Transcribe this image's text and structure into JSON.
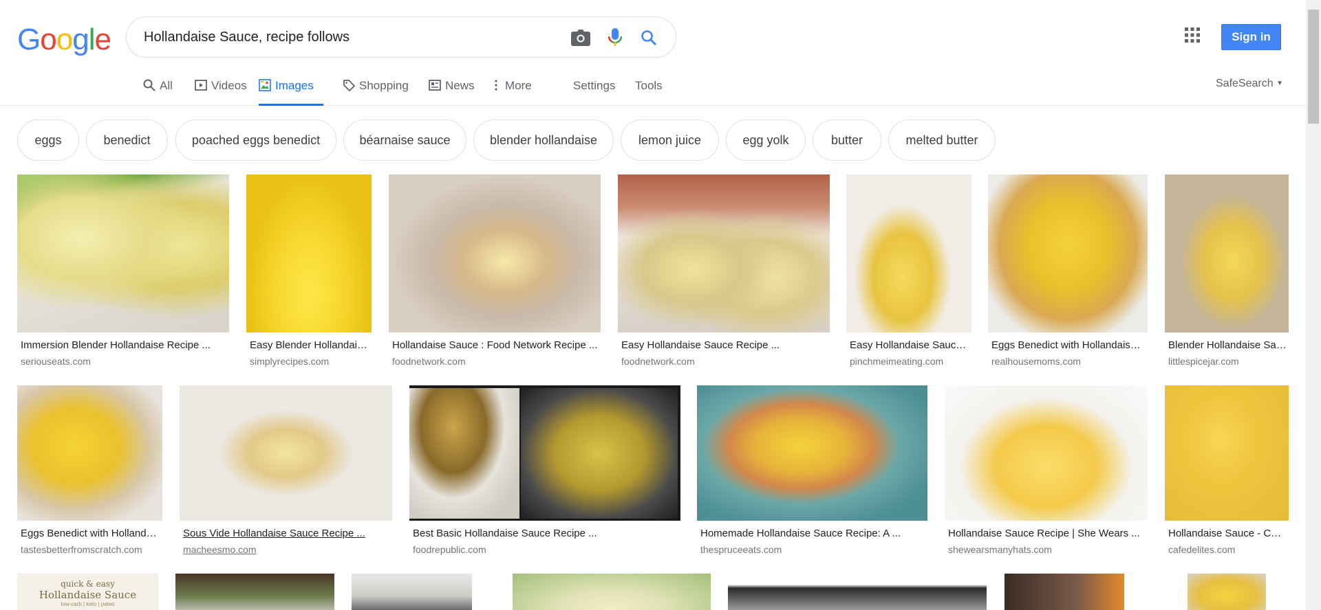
{
  "logo": {
    "letters": [
      "G",
      "o",
      "o",
      "g",
      "l",
      "e"
    ],
    "colors": [
      "#4285f4",
      "#ea4335",
      "#fbbc05",
      "#4285f4",
      "#34a853",
      "#ea4335"
    ]
  },
  "search": {
    "query": "Hollandaise Sauce, recipe follows"
  },
  "header": {
    "sign_in": "Sign in",
    "safesearch": "SafeSearch"
  },
  "tabs": [
    {
      "label": "All",
      "icon": "search-icon"
    },
    {
      "label": "Videos",
      "icon": "video-icon"
    },
    {
      "label": "Images",
      "icon": "image-icon",
      "active": true
    },
    {
      "label": "Shopping",
      "icon": "tag-icon"
    },
    {
      "label": "News",
      "icon": "newspaper-icon"
    },
    {
      "label": "More",
      "icon": "more-vert-icon"
    },
    {
      "label": "Settings"
    },
    {
      "label": "Tools"
    }
  ],
  "chips": [
    "eggs",
    "benedict",
    "poached eggs benedict",
    "béarnaise sauce",
    "blender hollandaise",
    "lemon juice",
    "egg yolk",
    "butter",
    "melted butter"
  ],
  "results_row1": [
    {
      "title": "Immersion Blender Hollandaise Recipe ...",
      "domain": "seriouseats.com"
    },
    {
      "title": "Easy Blender Hollandaise ...",
      "domain": "simplyrecipes.com"
    },
    {
      "title": "Hollandaise Sauce : Food Network Recipe ...",
      "domain": "foodnetwork.com"
    },
    {
      "title": "Easy Hollandaise Sauce Recipe ...",
      "domain": "foodnetwork.com"
    },
    {
      "title": "Easy Hollandaise Sauce ...",
      "domain": "pinchmeimeating.com"
    },
    {
      "title": "Eggs Benedict with Hollandaise ...",
      "domain": "realhousemoms.com"
    },
    {
      "title": "Blender Hollandaise Sauce ...",
      "domain": "littlespicejar.com"
    }
  ],
  "results_row2": [
    {
      "title": "Eggs Benedict with Hollandaise ...",
      "domain": "tastesbetterfromscratch.com"
    },
    {
      "title": "Sous Vide Hollandaise Sauce Recipe ...",
      "domain": "macheesmo.com"
    },
    {
      "title": "Best Basic Hollandaise Sauce Recipe ...",
      "domain": "foodrepublic.com"
    },
    {
      "title": "Homemade Hollandaise Sauce Recipe: A ...",
      "domain": "thespruceeats.com"
    },
    {
      "title": "Hollandaise Sauce Recipe | She Wears ...",
      "domain": "shewearsmanyhats.com"
    },
    {
      "title": "Hollandaise Sauce - Cafe ...",
      "domain": "cafedelites.com"
    }
  ],
  "row3_thumb_text": {
    "line1": "quick & easy",
    "line2": "Hollandaise Sauce",
    "line3": "low-carb | keto | paleo"
  }
}
